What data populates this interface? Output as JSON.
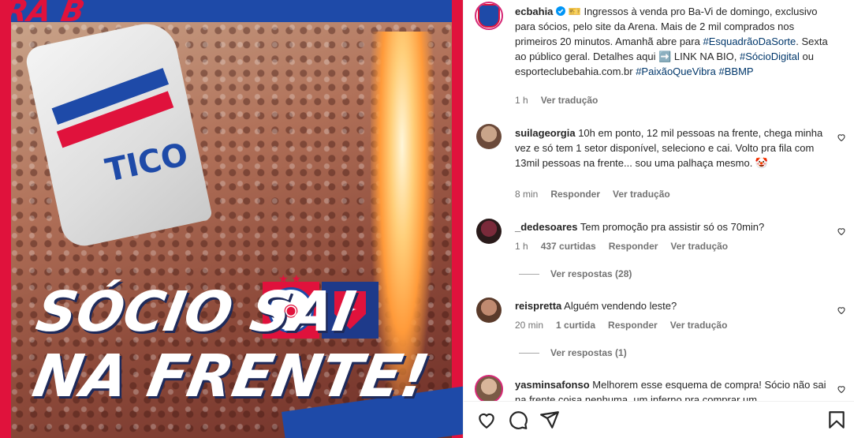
{
  "post_image": {
    "frame_text": "RA B",
    "flag_text": "TICO",
    "headline_line1": "SÓCIO SAI",
    "headline_line2": "NA FRENTE!",
    "colors": {
      "red": "#e0123c",
      "blue": "#1e4aa8"
    }
  },
  "caption": {
    "username": "ecbahia",
    "verified_icon": "verified-badge-icon",
    "text_parts": [
      "🎫 Ingressos à venda pro Ba-Vi de domingo, exclusivo para sócios, pelo site da Arena. Mais de 2 mil comprados nos primeiros 20 minutos. Amanhã abre para ",
      "#EsquadrãoDaSorte",
      ". Sexta ao público geral. Detalhes aqui ➡️ LINK NA BIO, ",
      "#SócioDigital",
      " ou esporteclubebahia.com.br ",
      "#PaixãoQueVibra",
      " ",
      "#BBMP"
    ],
    "time": "1 h",
    "translate": "Ver tradução"
  },
  "comments": [
    {
      "username": "suilageorgia",
      "text": "10h em ponto, 12 mil pessoas na frente, chega minha vez e só tem 1 setor disponível, seleciono e cai. Volto pra fila com 13mil pessoas na frente... sou uma palhaça mesmo. 🤡",
      "time": "8 min",
      "likes": "",
      "reply": "Responder",
      "translate": "Ver tradução"
    },
    {
      "username": "_dedesoares",
      "text": "Tem promoção pra assistir só os 70min?",
      "time": "1 h",
      "likes": "437 curtidas",
      "reply": "Responder",
      "translate": "Ver tradução",
      "view_replies": "Ver respostas (28)"
    },
    {
      "username": "reispretta",
      "text": "Alguém vendendo leste?",
      "time": "20 min",
      "likes": "1 curtida",
      "reply": "Responder",
      "translate": "Ver tradução",
      "view_replies": "Ver respostas (1)"
    },
    {
      "username": "yasminsafonso",
      "text": "Melhorem esse esquema de compra! Sócio não sai na frente coisa nenhuma, um inferno pra comprar um"
    }
  ],
  "icons": {
    "like": "heart-icon",
    "comment": "comment-icon",
    "share": "share-icon",
    "save": "bookmark-icon"
  }
}
